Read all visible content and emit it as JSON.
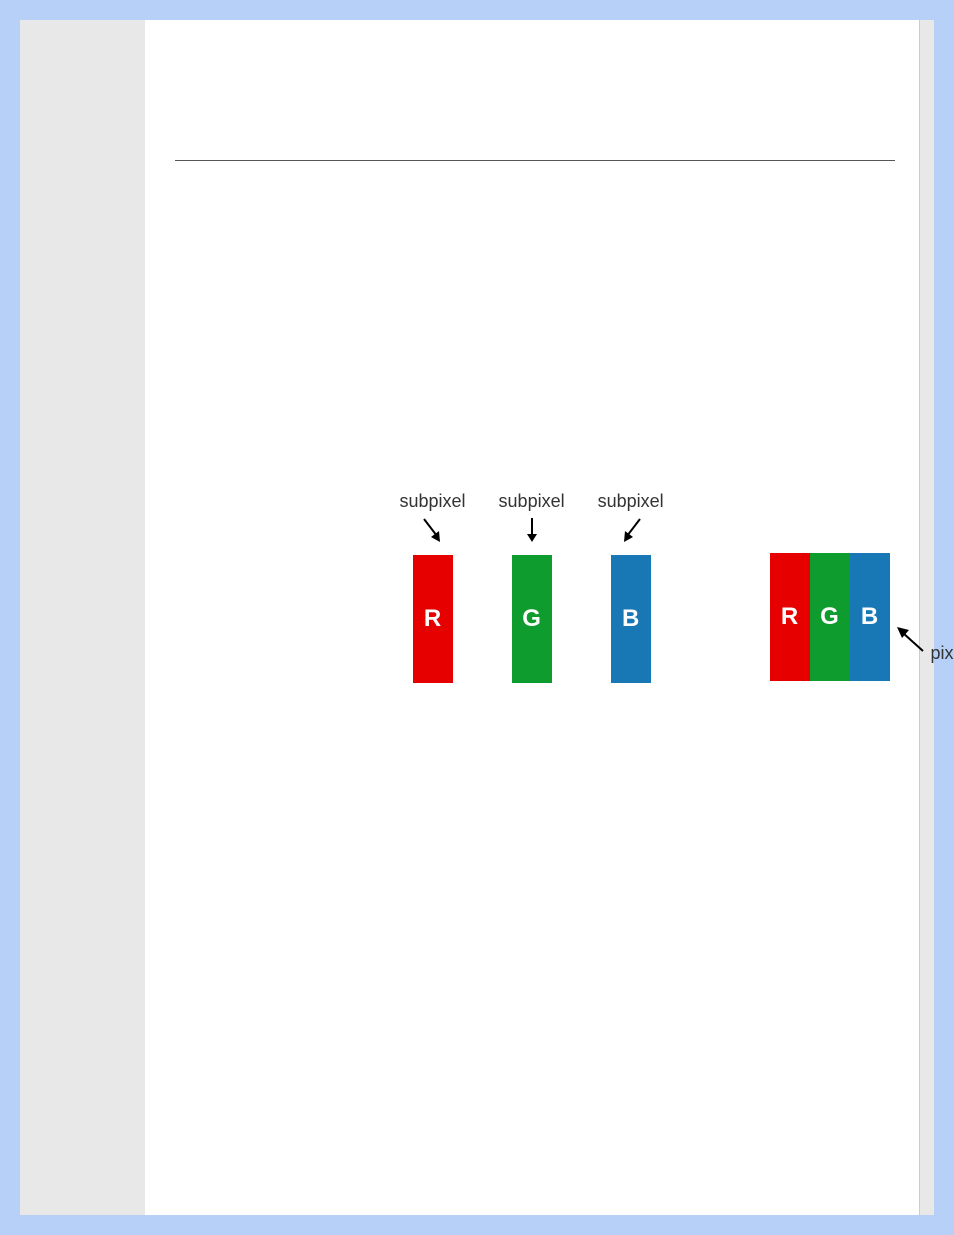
{
  "diagram": {
    "subpixels": [
      {
        "label": "subpixel",
        "letter": "R",
        "color_name": "red"
      },
      {
        "label": "subpixel",
        "letter": "G",
        "color_name": "green"
      },
      {
        "label": "subpixel",
        "letter": "B",
        "color_name": "blue"
      }
    ],
    "pixel": {
      "label": "pixel",
      "cells": [
        {
          "letter": "R",
          "color_name": "red"
        },
        {
          "letter": "G",
          "color_name": "green"
        },
        {
          "letter": "B",
          "color_name": "blue"
        }
      ]
    },
    "colors": {
      "red": "#e60000",
      "green": "#0f9c2f",
      "blue": "#1878b5"
    }
  }
}
